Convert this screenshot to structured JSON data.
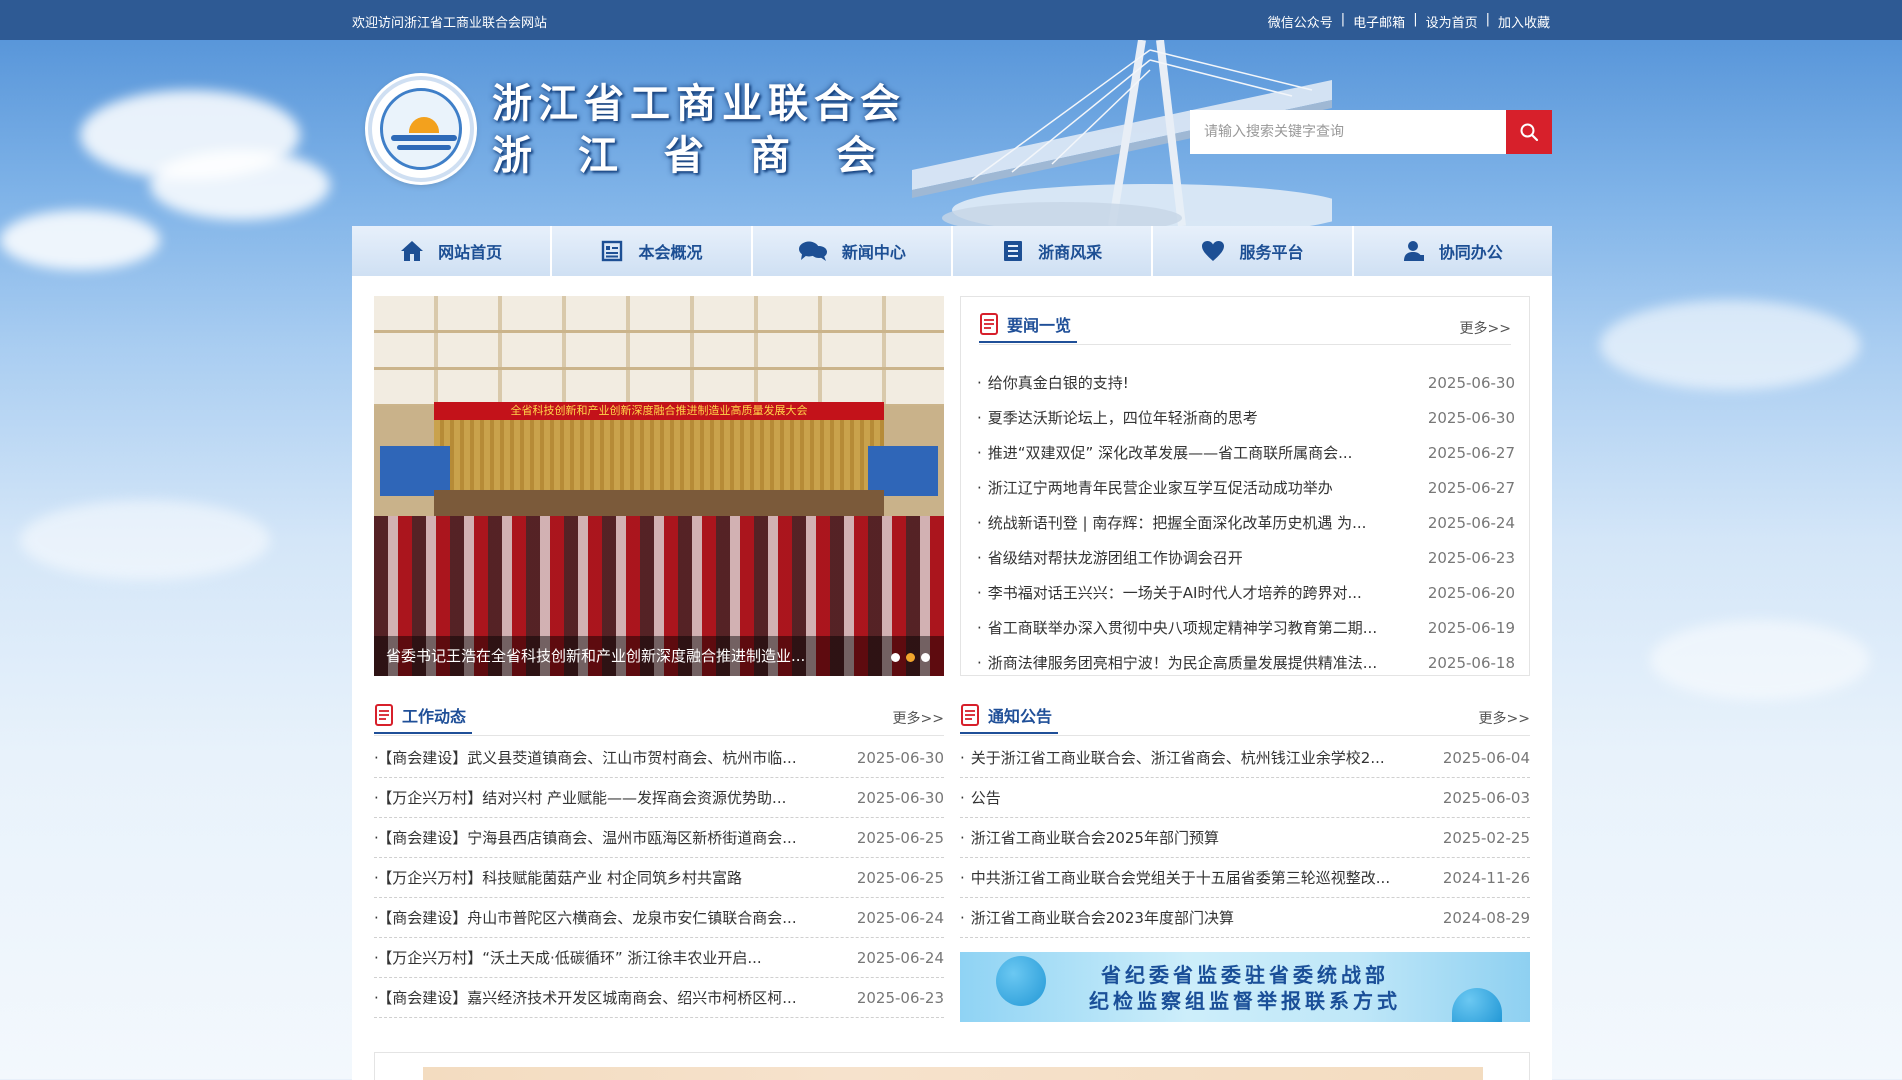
{
  "topbar": {
    "welcome": "欢迎访问浙江省工商业联合会网站",
    "links": [
      "微信公众号",
      "电子邮箱",
      "设为首页",
      "加入收藏"
    ],
    "separator": "|"
  },
  "header": {
    "title_line1": "浙江省工商业联合会",
    "title_line2": "浙江省商会",
    "search_placeholder": "请输入搜索关键字查询",
    "colors": {
      "topbar": "#2e5a94",
      "search_button": "#d7202b",
      "accent": "#1f4f98"
    }
  },
  "nav": {
    "items": [
      {
        "label": "网站首页",
        "icon": "home-icon"
      },
      {
        "label": "本会概况",
        "icon": "overview-icon"
      },
      {
        "label": "新闻中心",
        "icon": "chat-icon"
      },
      {
        "label": "浙商风采",
        "icon": "document-icon"
      },
      {
        "label": "服务平台",
        "icon": "heart-icon"
      },
      {
        "label": "协同办公",
        "icon": "user-icon"
      }
    ]
  },
  "slider": {
    "banner": "全省科技创新和产业创新深度融合推进制造业高质量发展大会",
    "caption": "省委书记王浩在全省科技创新和产业创新深度融合推进制造业...",
    "dots": 3,
    "active_dot": 2
  },
  "news": {
    "title": "要闻一览",
    "more": "更多>>",
    "items": [
      {
        "title": "给你真金白银的支持!",
        "date": "2025-06-30"
      },
      {
        "title": "夏季达沃斯论坛上，四位年轻浙商的思考",
        "date": "2025-06-30"
      },
      {
        "title": "推进“双建双促” 深化改革发展——省工商联所属商会...",
        "date": "2025-06-27"
      },
      {
        "title": "浙江辽宁两地青年民营企业家互学互促活动成功举办",
        "date": "2025-06-27"
      },
      {
        "title": "统战新语刊登 | 南存辉：把握全面深化改革历史机遇 为...",
        "date": "2025-06-24"
      },
      {
        "title": "省级结对帮扶龙游团组工作协调会召开",
        "date": "2025-06-23"
      },
      {
        "title": "李书福对话王兴兴：一场关于AI时代人才培养的跨界对...",
        "date": "2025-06-20"
      },
      {
        "title": "省工商联举办深入贯彻中央八项规定精神学习教育第二期...",
        "date": "2025-06-19"
      },
      {
        "title": "浙商法律服务团亮相宁波！为民企高质量发展提供精准法...",
        "date": "2025-06-18"
      }
    ]
  },
  "work": {
    "title": "工作动态",
    "more": "更多>>",
    "items": [
      {
        "title": "【商会建设】武义县茭道镇商会、江山市贺村商会、杭州市临...",
        "date": "2025-06-30"
      },
      {
        "title": "【万企兴万村】结对兴村 产业赋能——发挥商会资源优势助...",
        "date": "2025-06-30"
      },
      {
        "title": "【商会建设】宁海县西店镇商会、温州市瓯海区新桥街道商会...",
        "date": "2025-06-25"
      },
      {
        "title": "【万企兴万村】科技赋能菌菇产业 村企同筑乡村共富路",
        "date": "2025-06-25"
      },
      {
        "title": "【商会建设】舟山市普陀区六横商会、龙泉市安仁镇联合商会...",
        "date": "2025-06-24"
      },
      {
        "title": "【万企兴万村】“沃土天成·低碳循环” 浙江徐丰农业开启...",
        "date": "2025-06-24"
      },
      {
        "title": "【商会建设】嘉兴经济技术开发区城南商会、绍兴市柯桥区柯...",
        "date": "2025-06-23"
      }
    ]
  },
  "notice": {
    "title": "通知公告",
    "more": "更多>>",
    "items": [
      {
        "title": "关于浙江省工商业联合会、浙江省商会、杭州钱江业余学校2...",
        "date": "2025-06-04"
      },
      {
        "title": "公告",
        "date": "2025-06-03"
      },
      {
        "title": "浙江省工商业联合会2025年部门预算",
        "date": "2025-02-25"
      },
      {
        "title": "中共浙江省工商业联合会党组关于十五届省委第三轮巡视整改...",
        "date": "2024-11-26"
      },
      {
        "title": "浙江省工商业联合会2023年度部门决算",
        "date": "2024-08-29"
      }
    ]
  },
  "promo": {
    "line1": "省纪委省监委驻省委统战部",
    "line2": "纪检监察组监督举报联系方式"
  }
}
